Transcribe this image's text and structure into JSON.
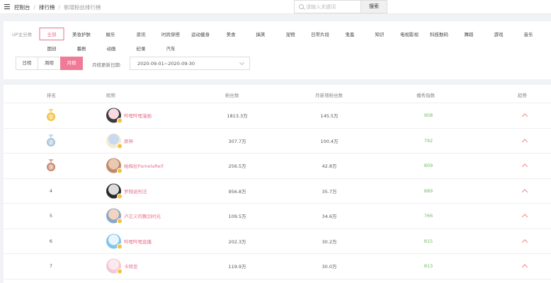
{
  "breadcrumb": {
    "items": [
      "控制台",
      "排行榜"
    ],
    "current": "新增粉丝排行榜"
  },
  "search": {
    "placeholder": "请输入关键词",
    "button_label": "搜索"
  },
  "categories": {
    "label": "UP主分类",
    "items": [
      "全部",
      "美妆护肤",
      "娱乐",
      "资讯",
      "时尚穿搭",
      "运动健身",
      "美食",
      "搞笑",
      "宠物",
      "日常片段",
      "鬼畜",
      "知识",
      "电视影视",
      "科技数码",
      "舞蹈",
      "游戏",
      "音乐",
      "国创",
      "番剧",
      "动画",
      "纪录",
      "汽车"
    ],
    "selected": "全部"
  },
  "periods": {
    "items": [
      "日榜",
      "周榜",
      "月榜"
    ],
    "selected": "月榜"
  },
  "date_filter": {
    "label": "月榜更新日期:",
    "value": "2020-09-01~2020-09-30"
  },
  "table": {
    "headers": [
      "排名",
      "昵称",
      "粉丝数",
      "月新增粉丝数",
      "播秀指数",
      "趋势"
    ],
    "rows": [
      {
        "rank": "1",
        "name": "哔哩哔哩漫画",
        "fans": "1813.3万",
        "new_fans": "145.5万",
        "index": "908",
        "medal": "gold"
      },
      {
        "rank": "2",
        "name": "原神",
        "fans": "307.7万",
        "new_fans": "100.4万",
        "index": "792",
        "medal": "silver"
      },
      {
        "rank": "3",
        "name": "帕梅拉PamelaReif",
        "fans": "256.5万",
        "new_fans": "42.8万",
        "index": "809",
        "medal": "bronze"
      },
      {
        "rank": "4",
        "name": "罗翔说刑法",
        "fans": "956.8万",
        "new_fans": "35.7万",
        "index": "889",
        "medal": ""
      },
      {
        "rank": "5",
        "name": "卢正义的飘剑时光",
        "fans": "109.5万",
        "new_fans": "34.6万",
        "index": "766",
        "medal": ""
      },
      {
        "rank": "6",
        "name": "哔哩哔哩直播",
        "fans": "202.3万",
        "new_fans": "30.2万",
        "index": "815",
        "medal": ""
      },
      {
        "rank": "7",
        "name": "卡特亚",
        "fans": "119.9万",
        "new_fans": "30.0万",
        "index": "813",
        "medal": ""
      }
    ]
  },
  "colors": {
    "accent": "#f07b98",
    "name_pink": "#e5748f",
    "index_green": "#6dbf5c",
    "trend_red": "#ef8a8a",
    "gold": "#f5c23e",
    "silver": "#a9c4d9",
    "bronze": "#c98a6e"
  }
}
